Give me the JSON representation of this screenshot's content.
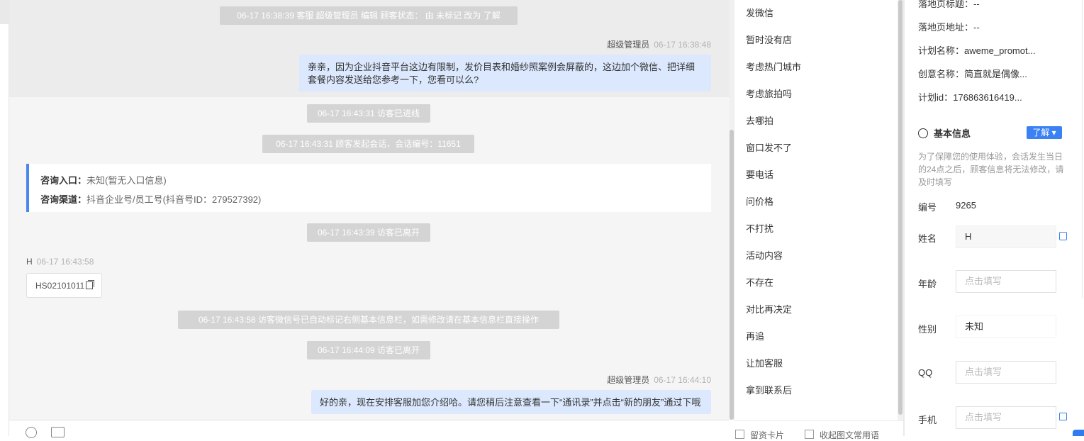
{
  "chat": {
    "events": [
      "06-17 16:38:39 客服 超级管理员 编辑 顾客状态： 由 未标记 改为 了解",
      "06-17 16:43:31 访客已进线",
      "06-17 16:43:31 顾客发起会话，会话编号：11651",
      "06-17 16:43:39 访客已离开",
      "06-17 16:43:58 访客微信号已自动标记右侧基本信息栏，如需修改请在基本信息栏直接操作",
      "06-17 16:44:09 访客已离开"
    ],
    "msg1": {
      "sender": "超级管理员",
      "time": "06-17 16:38:48",
      "text": "亲亲，因为企业抖音平台这边有限制，发价目表和婚纱照案例会屏蔽的，这边加个微信、把详细套餐内容发送给您参考一下，您看可以么?"
    },
    "entry_card": {
      "entry_label": "咨询入口：",
      "entry_value": "未知(暂无入口信息)",
      "channel_label": "咨询渠道：",
      "channel_value": "抖音企业号/员工号(抖音号ID：279527392)"
    },
    "visitor_msg": {
      "sender": "H",
      "time": "06-17 16:43:58",
      "text": "HS02101011"
    },
    "msg2": {
      "sender": "超级管理员",
      "time": "06-17 16:44:10",
      "text": "好的亲，现在安排客服加您介绍哈。请您稍后注意查看一下“通讯录”并点击“新的朋友”通过下哦"
    }
  },
  "quick_replies": [
    "发微信",
    "暂时没有店",
    "考虑热门城市",
    "考虑旅拍吗",
    "去哪拍",
    "窗口发不了",
    "要电话",
    "问价格",
    "不打扰",
    "活动内容",
    "不存在",
    "对比再决定",
    "再追",
    "让加客服",
    "拿到联系后"
  ],
  "quick_footer": {
    "left": "留资卡片",
    "right": "收起图文常用语"
  },
  "info": {
    "lines": [
      "落地页标题：--",
      "落地页地址：--",
      "计划名称：aweme_promot...",
      "创意名称：简直就是偶像...",
      "计划id：176863616419..."
    ],
    "basic_title": "基本信息",
    "status_button": "了解",
    "hint": "为了保障您的使用体验，会话发生当日的24点之后，顾客信息将无法修改，请及时填写",
    "id_label": "编号",
    "id_value": "9265",
    "name_label": "姓名",
    "name_value": "H",
    "age_label": "年龄",
    "age_placeholder": "点击填写",
    "gender_label": "性别",
    "gender_value": "未知",
    "qq_label": "QQ",
    "qq_placeholder": "点击填写",
    "phone_label": "手机",
    "phone_placeholder": "点击填写"
  },
  "colors": {
    "accent": "#3a82f3",
    "bubble": "#dbe8fd",
    "system_pill": "#d4d4d4"
  }
}
